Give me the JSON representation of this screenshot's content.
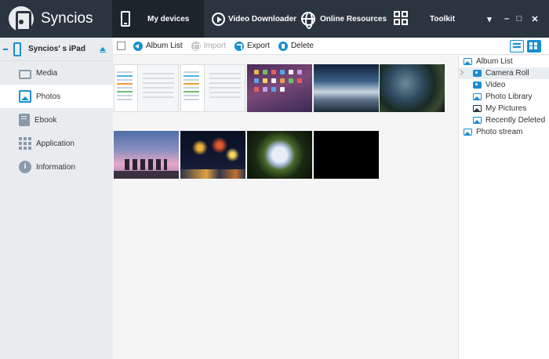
{
  "app": {
    "title": "Syncios"
  },
  "nav": {
    "tabs": [
      {
        "label": "My devices",
        "icon": "device-icon",
        "active": true
      },
      {
        "label": "Video Downloader",
        "icon": "play-circle-icon"
      },
      {
        "label": "Online Resources",
        "icon": "globe-icon"
      },
      {
        "label": "Toolkit",
        "icon": "grid-icon"
      }
    ],
    "window_controls": [
      "▾",
      "–",
      "□",
      "✕"
    ]
  },
  "sidebar": {
    "device_name": "Syncios' s iPad",
    "items": [
      {
        "label": "Media",
        "icon": "tv-icon"
      },
      {
        "label": "Photos",
        "icon": "photo-icon",
        "active": true
      },
      {
        "label": "Ebook",
        "icon": "book-icon"
      },
      {
        "label": "Application",
        "icon": "apps-icon"
      },
      {
        "label": "Information",
        "icon": "info-icon"
      }
    ]
  },
  "toolbar": {
    "album_list": "Album List",
    "import": "Import",
    "export": "Export",
    "delete": "Delete"
  },
  "album_tree": {
    "root": "Album List",
    "children": [
      "Camera Roll",
      "Video",
      "Photo Library",
      "My Pictures",
      "Recently Deleted"
    ],
    "photo_stream": "Photo stream"
  },
  "colors": {
    "topbar": "#2b3540",
    "accent": "#1a8ed1",
    "sidebar": "#e9ecef"
  }
}
